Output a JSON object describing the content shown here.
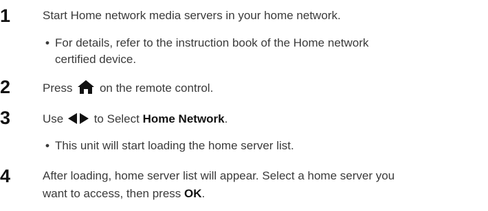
{
  "steps": [
    {
      "number": "1",
      "text": "Start Home network media servers in your home network.",
      "note_line1": "For details, refer to the instruction book of the Home network",
      "note_line2": "certified device."
    },
    {
      "number": "2",
      "text_before": "Press",
      "icon": "home-icon",
      "text_after": "on the remote control."
    },
    {
      "number": "3",
      "text_before": "Use",
      "icon": "left-right-arrows-icon",
      "text_middle": "to Select",
      "emphasis": "Home Network",
      "text_end": ".",
      "note": "This unit will start loading the home server list."
    },
    {
      "number": "4",
      "line1": "After loading, home server list will appear. Select a home server you",
      "line2_before": "want to access, then press",
      "emphasis": "OK",
      "line2_end": "."
    }
  ],
  "bullet": "•",
  "colors": {
    "text": "#3a3a3a",
    "number": "#111111"
  }
}
